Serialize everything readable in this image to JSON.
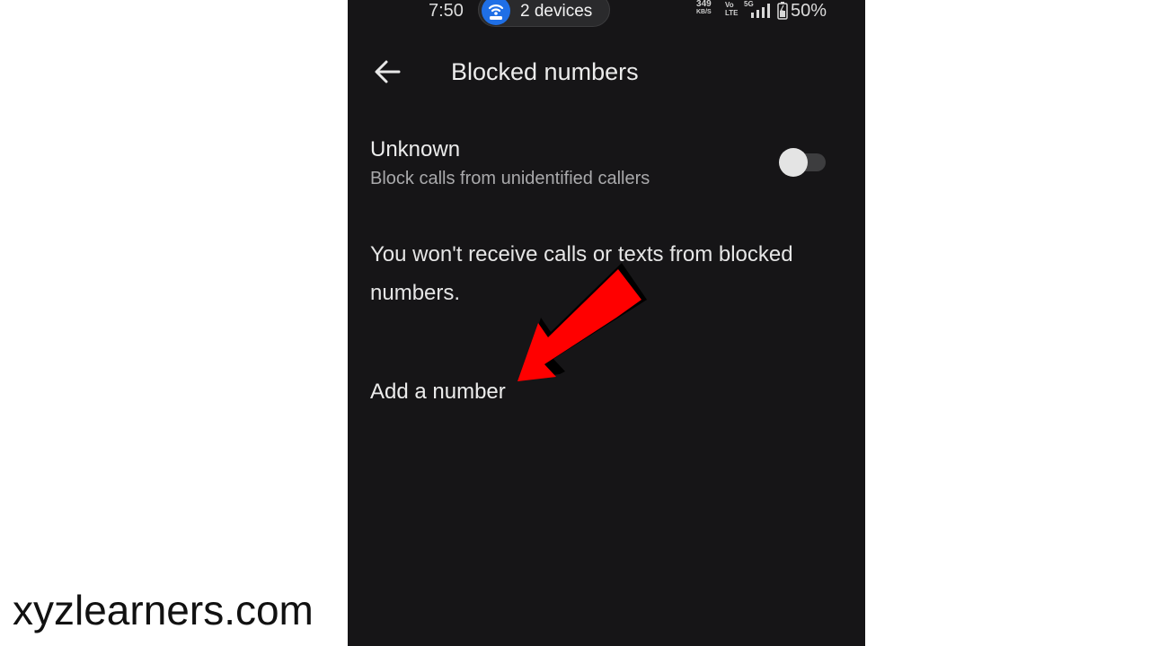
{
  "status_bar": {
    "time": "7:50",
    "hotspot_label": "2 devices",
    "speed_value": "349",
    "speed_unit": "KB/S",
    "volte_top": "Vo",
    "volte_bottom": "LTE",
    "network": "5G",
    "battery_percent": "50%",
    "icons": [
      "hotspot-icon",
      "signal-bars-icon",
      "battery-icon"
    ]
  },
  "header": {
    "title": "Blocked numbers",
    "back_icon": "arrow-left-icon"
  },
  "unknown_setting": {
    "title": "Unknown",
    "subtitle": "Block calls from unidentified callers",
    "toggle_on": false
  },
  "info": {
    "text": "You won't receive calls or texts from blocked numbers."
  },
  "actions": {
    "add_number": "Add a number"
  },
  "annotation": {
    "arrow_color": "#ff0000"
  },
  "watermark": {
    "text": "xyzlearners.com"
  },
  "colors": {
    "screen_background": "#161517",
    "hotspot_accent": "#1f6fe6"
  }
}
